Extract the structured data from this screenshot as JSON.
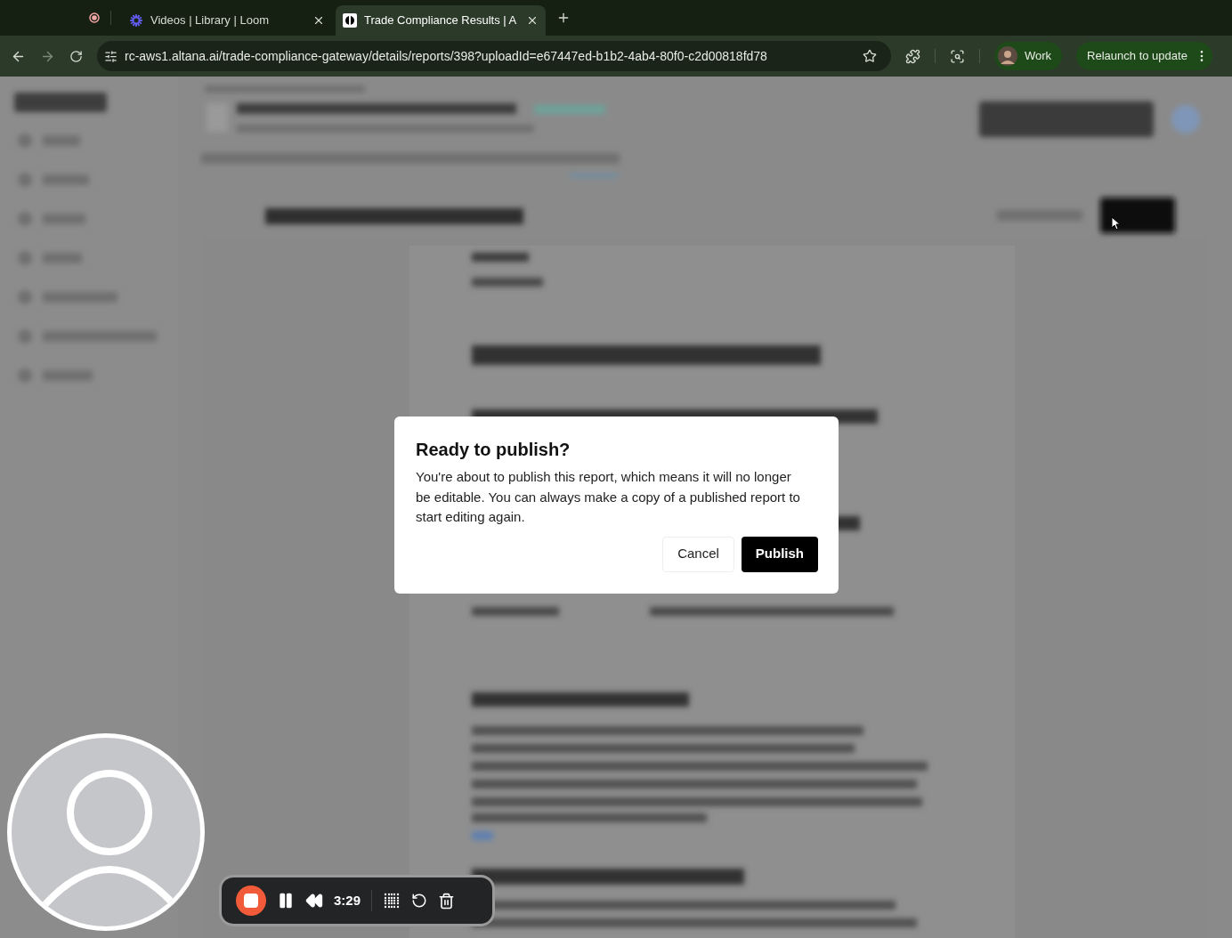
{
  "browser": {
    "tabs": [
      {
        "title": "Videos | Library | Loom",
        "kind": "loom",
        "selected": false
      },
      {
        "title": "Trade Compliance Results | A",
        "kind": "altana",
        "selected": true
      }
    ],
    "url": "rc-aws1.altana.ai/trade-compliance-gateway/details/reports/398?uploadId=e67447ed-b1b2-4ab4-80f0-c2d00818fd78",
    "profile": "Work",
    "update_button": "Relaunch to update"
  },
  "dialog": {
    "title": "Ready to publish?",
    "body": "You're about to publish this report, which means it will no longer be editable. You can always make a copy of a published report to start editing again.",
    "buttons": [
      {
        "label": "Cancel",
        "kind": "secondary"
      },
      {
        "label": "Publish",
        "kind": "primary"
      }
    ]
  },
  "recorder": {
    "time": "3:29"
  }
}
